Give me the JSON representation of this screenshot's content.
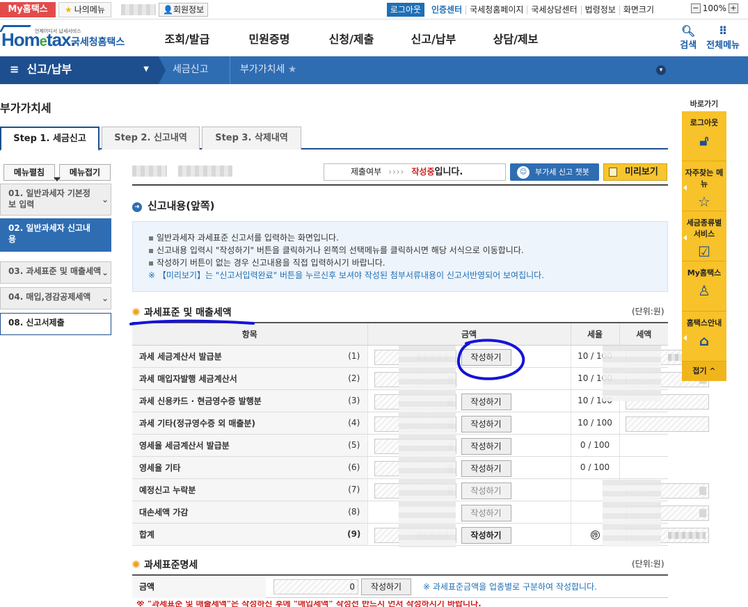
{
  "topbar": {
    "my_hometax": "My홈택스",
    "my_menu": "나의메뉴",
    "member_info": "회원정보",
    "logout": "로그아웃",
    "cert_center": "인증센터",
    "links": [
      "국세청홈페이지",
      "국세상담센터",
      "법령정보",
      "화면크기"
    ],
    "zoom": "100%",
    "zoom_minus": "−",
    "zoom_plus": "+"
  },
  "header": {
    "logo_text": "Hom",
    "logo_e": "e",
    "logo_tail": "tax.",
    "logo_kor": "국세청홈택스",
    "logo_tiny": "언제어디서 납세서비스",
    "menu": [
      "조회/발급",
      "민원증명",
      "신청/제출",
      "신고/납부",
      "상담/제보"
    ],
    "search": "검색",
    "all_menu": "전체메뉴"
  },
  "navbar": {
    "current": "신고/납부",
    "crumb1": "세금신고",
    "crumb2": "부가가치세"
  },
  "page": {
    "title": "부가가치세",
    "tabs": [
      "Step 1. 세금신고",
      "Step 2. 신고내역",
      "Step 3. 삭제내역"
    ]
  },
  "left_menu": {
    "edit": "메뉴펼침",
    "fold": "메뉴접기",
    "items": [
      "01. 일반과세자 기본정보 입력",
      "02. 일반과세자 신고내용",
      "03. 과세표준 및 매출세액",
      "04. 매입,경감공제세액",
      "08. 신고서제출"
    ]
  },
  "status": {
    "label": "제출여부",
    "dots": "››››",
    "state": "작성중",
    "suffix": "입니다.",
    "chatbot": "부가세 신고 챗봇",
    "preview": "미리보기"
  },
  "section1": {
    "title": "신고내용(앞쪽)",
    "info": [
      "일반과세자 과세표준 신고서를 입력하는 화면입니다.",
      "신고내용 입력시 \"작성하기\" 버튼을 클릭하거나 왼쪽의 선택메뉴를 클릭하시면 해당 서식으로 이동합니다.",
      "작성하기 버튼이 없는 경우 신고내용을 직접 입력하시기 바랍니다."
    ],
    "note": "※ 【미리보기】는 \"신고서입력완료\" 버튼을 누르신후 보셔야 작성된 첨부서류내용이 신고서반영되어 보여집니다."
  },
  "section2": {
    "title": "과세표준 및 매출세액",
    "unit": "(단위:원)",
    "headers": [
      "항목",
      "금액",
      "세율",
      "세액"
    ],
    "write_label": "작성하기",
    "rows": [
      {
        "name": "과세 세금계산서 발급분",
        "no": "(1)",
        "rate": "10 / 100"
      },
      {
        "name": "과세 매입자발행 세금계산서",
        "no": "(2)",
        "rate": "10 / 100"
      },
      {
        "name": "과세 신용카드 · 현금영수증 발행분",
        "no": "(3)",
        "rate": "10 / 100"
      },
      {
        "name": "과세 기타(정규영수증 외 매출분)",
        "no": "(4)",
        "rate": "10 / 100"
      },
      {
        "name": "영세율 세금계산서 발급분",
        "no": "(5)",
        "rate": "0 / 100"
      },
      {
        "name": "영세율 기타",
        "no": "(6)",
        "rate": "0 / 100"
      },
      {
        "name": "예정신고 누락분",
        "no": "(7)",
        "rate": ""
      },
      {
        "name": "대손세액 가감",
        "no": "(8)",
        "rate": ""
      },
      {
        "name": "합계",
        "no": "(9)",
        "rate": "㉮"
      }
    ]
  },
  "section3": {
    "title": "과세표준명세",
    "unit": "(단위:원)",
    "label": "금액",
    "value": "0",
    "button": "작성하기",
    "note": "※ 과세표준금액을 업종별로 구분하여 작성합니다.",
    "warning": "※ \"과세표준 및 매출세액\"은 작성하신 후에 \"매입세액\" 작성전 반드시 먼저 작성하시기 바랍니다."
  },
  "quick": {
    "title": "바로가기",
    "items": [
      "로그아웃",
      "자주찾는 메뉴",
      "세금종류별 서비스",
      "My홈택스",
      "홈택스안내"
    ],
    "fold": "접기 ^"
  },
  "colors": {
    "brand_blue": "#2f6db2",
    "nav_dark": "#1d4f8f",
    "quick_yellow": "#f7c22a",
    "warning_red": "#d02020",
    "annotation": "#1414d8"
  }
}
